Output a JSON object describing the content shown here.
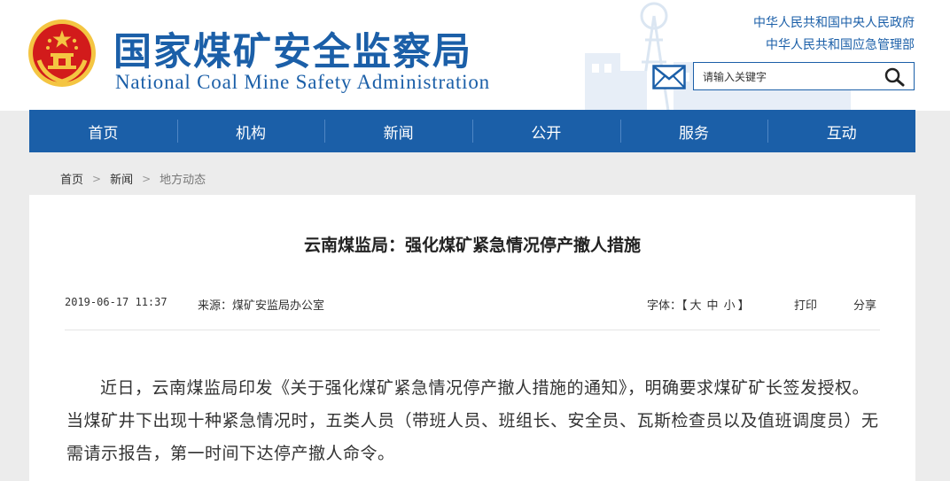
{
  "header": {
    "title_cn": "国家煤矿安全监察局",
    "title_en": "National Coal Mine Safety Administration",
    "gov_links": [
      "中华人民共和国中央人民政府",
      "中华人民共和国应急管理部"
    ],
    "search": {
      "placeholder": "请输入关键字"
    },
    "colors": {
      "brand": "#1b5fa8",
      "emblem_red": "#d21b1b",
      "emblem_gold": "#f4c542"
    }
  },
  "nav": {
    "items": [
      "首页",
      "机构",
      "新闻",
      "公开",
      "服务",
      "互动"
    ]
  },
  "breadcrumb": {
    "items": [
      "首页",
      "新闻",
      "地方动态"
    ],
    "separator": ">"
  },
  "article": {
    "title": "云南煤监局：强化煤矿紧急情况停产撤人措施",
    "datetime": "2019-06-17 11:37",
    "source": "来源：煤矿安监局办公室",
    "font_label": "字体：",
    "font_open": "【",
    "font_sizes": [
      "大",
      "中",
      "小"
    ],
    "font_close": "】",
    "print_label": "打印",
    "share_label": "分享",
    "paragraph": "近日，云南煤监局印发《关于强化煤矿紧急情况停产撤人措施的通知》，明确要求煤矿矿长签发授权。当煤矿井下出现十种紧急情况时，五类人员（带班人员、班组长、安全员、瓦斯检查员以及值班调度员）无需请示报告，第一时间下达停产撤人命令。"
  }
}
